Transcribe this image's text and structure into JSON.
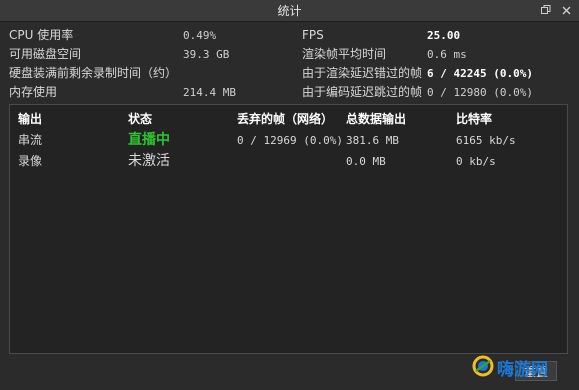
{
  "window": {
    "title": "统计"
  },
  "stats": [
    {
      "label": "CPU 使用率",
      "value": "0.49%",
      "label2": "FPS",
      "value2": "25.00",
      "bold2": true
    },
    {
      "label": "可用磁盘空间",
      "value": "39.3 GB",
      "label2": "渲染帧平均时间",
      "value2": "0.6 ms",
      "bold2": false
    },
    {
      "label": "硬盘装满前剩余录制时间（约）",
      "value": "",
      "label2": "由于渲染延迟错过的帧",
      "value2": "6 / 42245 (0.0%)",
      "bold2": true
    },
    {
      "label": "内存使用",
      "value": "214.4 MB",
      "label2": "由于编码延迟跳过的帧",
      "value2": "0 / 12980 (0.0%)",
      "bold2": false
    }
  ],
  "table": {
    "headers": [
      "输出",
      "状态",
      "丢弃的帧（网络）",
      "总数据输出",
      "比特率"
    ],
    "rows": [
      {
        "output": "串流",
        "status": "直播中",
        "dropped": "0 / 12969 (0.0%)",
        "total": "381.6 MB",
        "bitrate": "6165 kb/s"
      },
      {
        "output": "录像",
        "status": "未激活",
        "dropped": "",
        "total": "0.0 MB",
        "bitrate": "0 kb/s"
      }
    ]
  },
  "reset_label": "重置",
  "watermark_text": "嗨游网",
  "colors": {
    "live": "#2ec42e",
    "watermark": "#1a78d8"
  },
  "icons": [
    "restore-icon",
    "close-icon"
  ]
}
